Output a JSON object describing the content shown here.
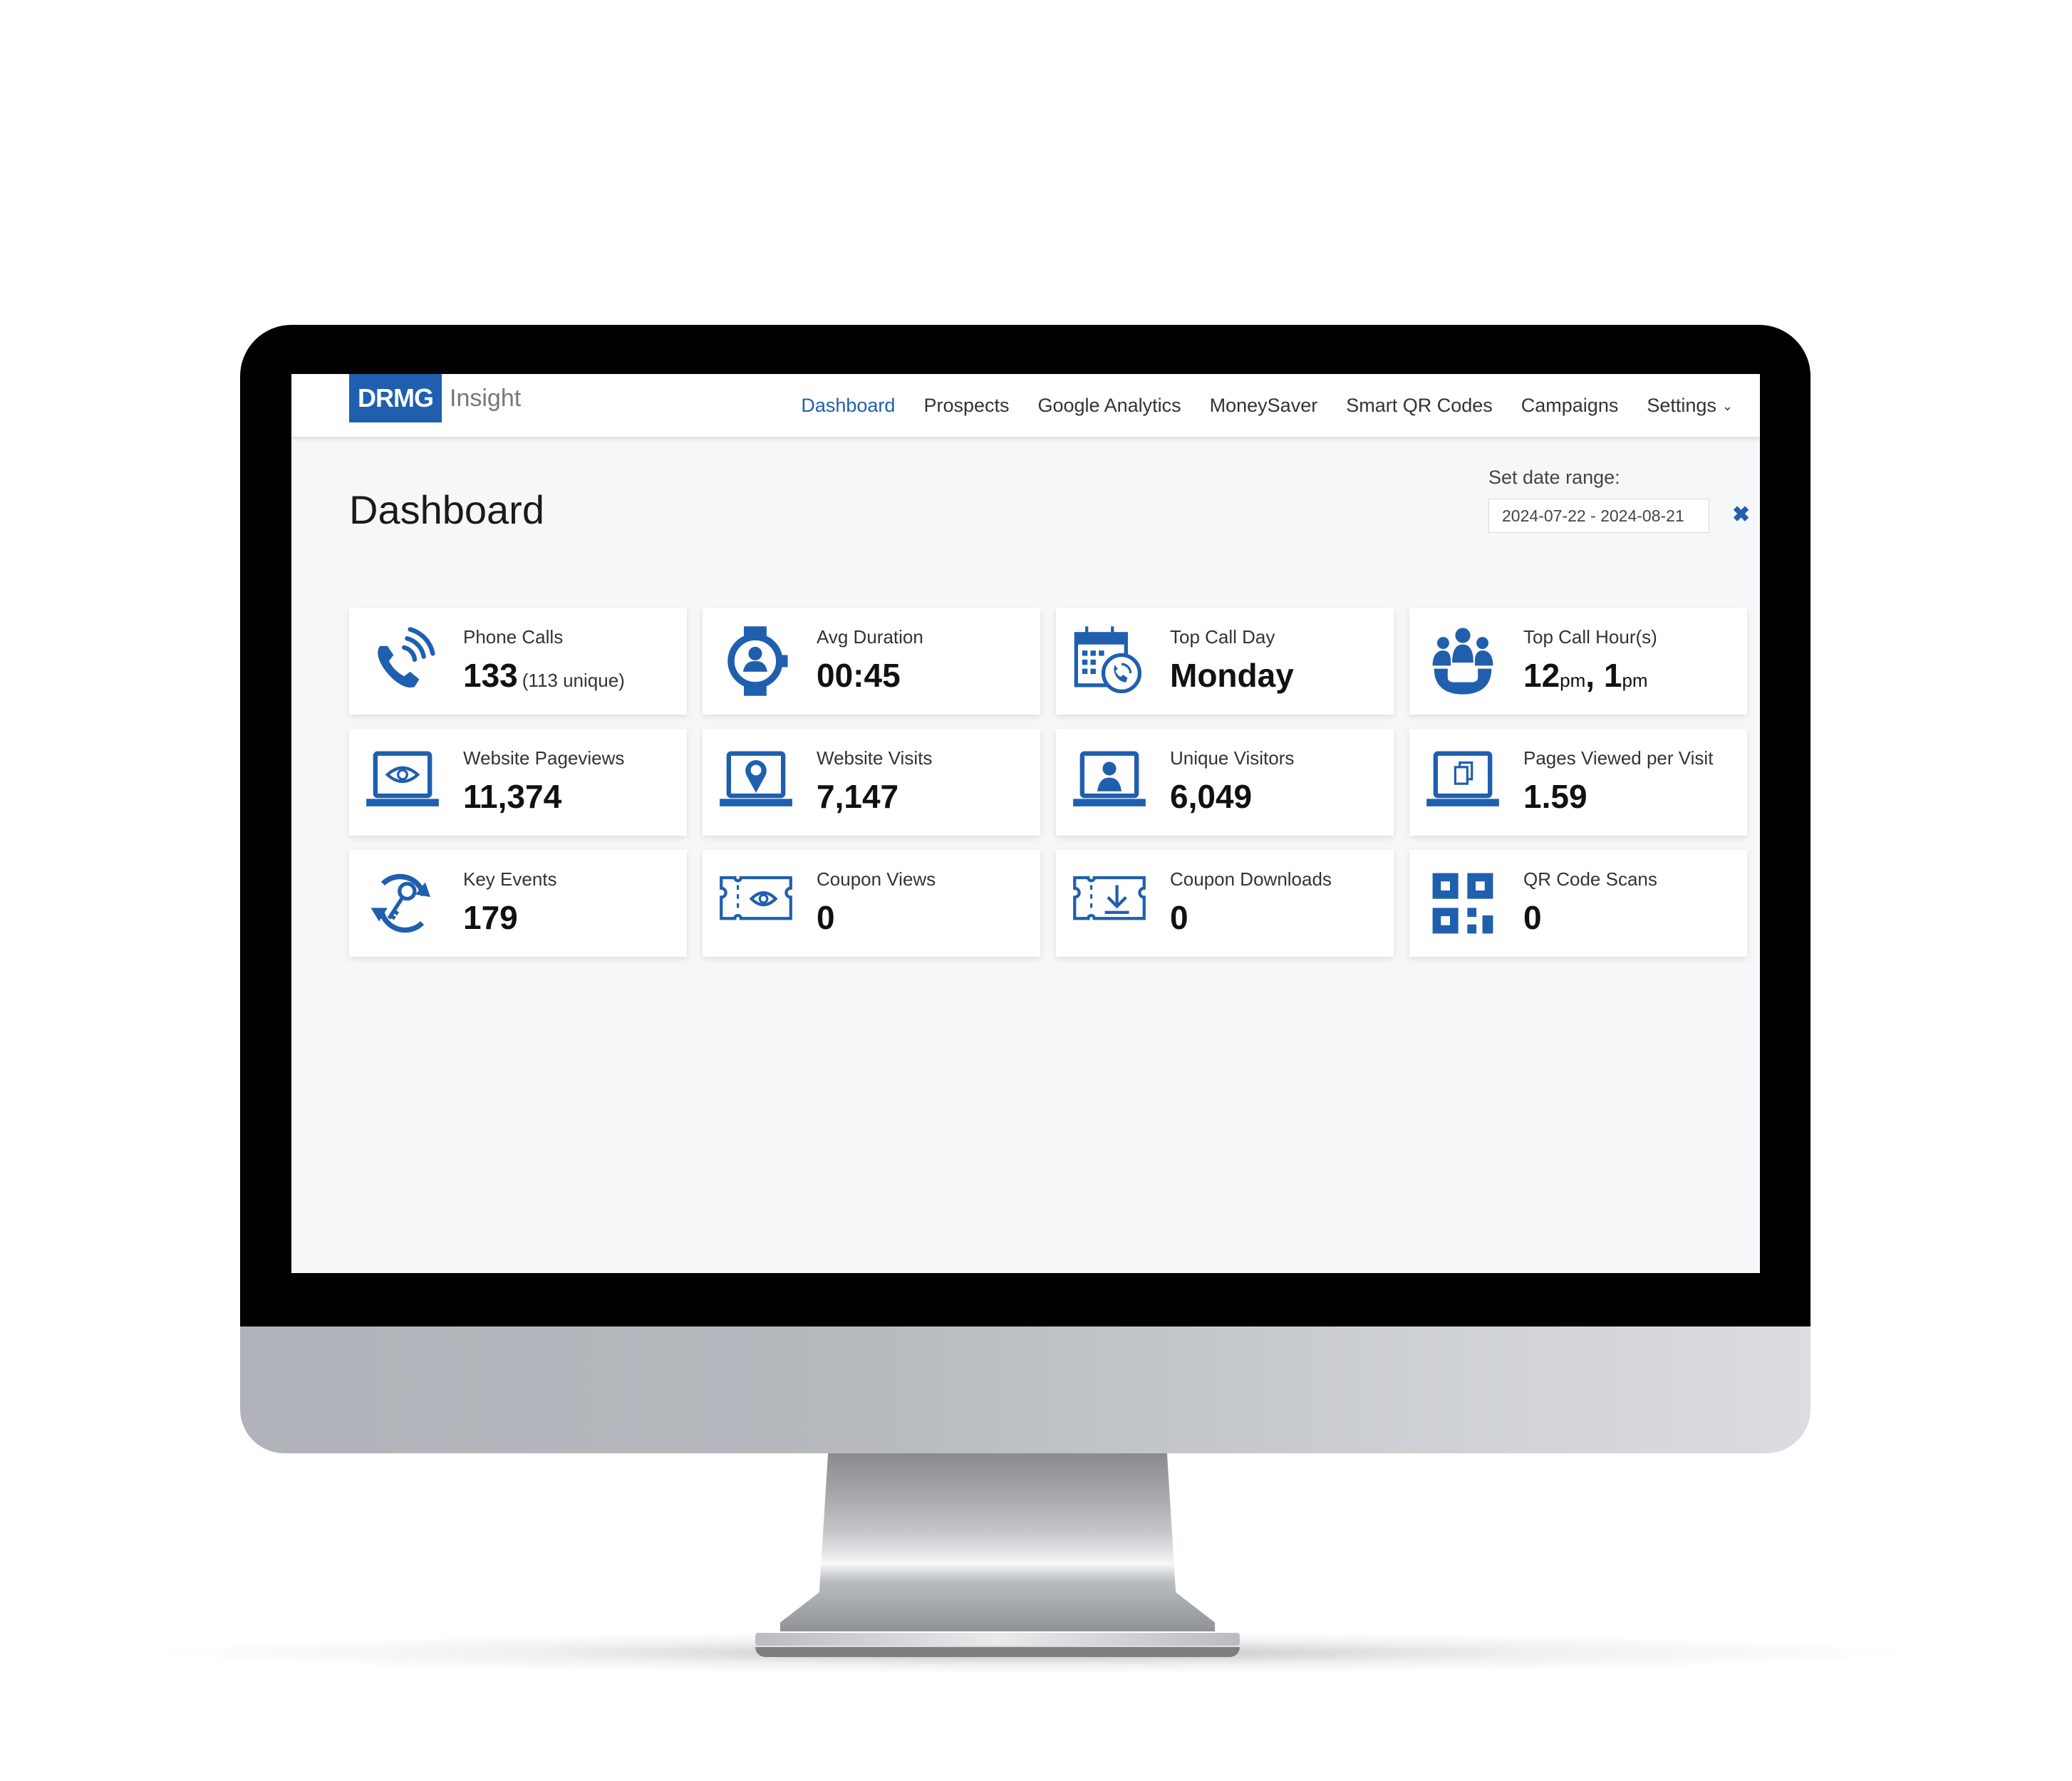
{
  "app": {
    "brand_box": "DRMG",
    "brand_text": "Insight"
  },
  "nav": {
    "items": [
      {
        "label": "Dashboard",
        "active": true
      },
      {
        "label": "Prospects"
      },
      {
        "label": "Google Analytics"
      },
      {
        "label": "MoneySaver"
      },
      {
        "label": "Smart QR Codes"
      },
      {
        "label": "Campaigns"
      },
      {
        "label": "Settings",
        "dropdown": true
      }
    ]
  },
  "page": {
    "title": "Dashboard"
  },
  "date_range": {
    "label": "Set date range:",
    "value": "2024-07-22 - 2024-08-21",
    "clear_icon": "close-icon"
  },
  "colors": {
    "accent": "#1f5fae"
  },
  "cards": [
    {
      "label": "Phone Calls",
      "value": "133",
      "sub": "(113 unique)",
      "icon": "phone-icon"
    },
    {
      "label": "Avg Duration",
      "value": "00:45",
      "icon": "watch-user-icon"
    },
    {
      "label": "Top Call Day",
      "value": "Monday",
      "icon": "calendar-phone-icon"
    },
    {
      "label": "Top Call Hour(s)",
      "value_parts": [
        "12",
        "pm",
        ", 1",
        "pm"
      ],
      "icon": "group-phone-icon"
    },
    {
      "label": "Website Pageviews",
      "value": "11,374",
      "icon": "laptop-eye-icon"
    },
    {
      "label": "Website Visits",
      "value": "7,147",
      "icon": "laptop-pin-icon"
    },
    {
      "label": "Unique Visitors",
      "value": "6,049",
      "icon": "laptop-user-icon"
    },
    {
      "label": "Pages Viewed per Visit",
      "value": "1.59",
      "icon": "laptop-pages-icon"
    },
    {
      "label": "Key Events",
      "value": "179",
      "icon": "key-cycle-icon"
    },
    {
      "label": "Coupon Views",
      "value": "0",
      "icon": "coupon-eye-icon"
    },
    {
      "label": "Coupon Downloads",
      "value": "0",
      "icon": "coupon-download-icon"
    },
    {
      "label": "QR Code Scans",
      "value": "0",
      "icon": "qr-code-icon"
    }
  ]
}
